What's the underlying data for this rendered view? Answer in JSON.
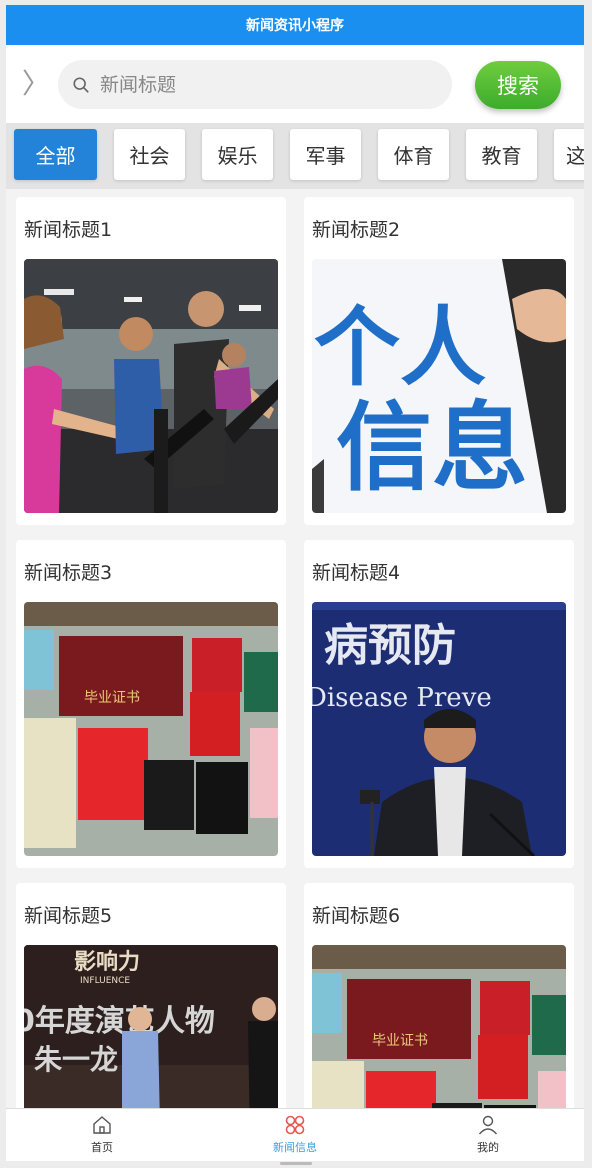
{
  "app": {
    "title": "新闻资讯小程序"
  },
  "search": {
    "placeholder": "新闻标题",
    "button_label": "搜索"
  },
  "tabs": [
    {
      "label": "全部",
      "active": true
    },
    {
      "label": "社会",
      "active": false
    },
    {
      "label": "娱乐",
      "active": false
    },
    {
      "label": "军事",
      "active": false
    },
    {
      "label": "体育",
      "active": false
    },
    {
      "label": "教育",
      "active": false
    },
    {
      "label": "这",
      "active": false
    }
  ],
  "news": [
    {
      "title": "新闻标题1",
      "image": "gym-photo"
    },
    {
      "title": "新闻标题2",
      "image": "personal-info-photo",
      "image_text": [
        "个人",
        "信息"
      ]
    },
    {
      "title": "新闻标题3",
      "image": "certificates-photo",
      "image_text": [
        "毕业证书"
      ]
    },
    {
      "title": "新闻标题4",
      "image": "press-conference-photo",
      "image_text": [
        "病预防",
        "Disease Preve"
      ]
    },
    {
      "title": "新闻标题5",
      "image": "stage-event-photo",
      "image_text": [
        "影响力",
        "INFLUENCE",
        "0年度演艺人物",
        "朱一龙"
      ]
    },
    {
      "title": "新闻标题6",
      "image": "certificates-photo",
      "image_text": [
        "毕业证书"
      ]
    }
  ],
  "bottom_nav": [
    {
      "label": "首页",
      "icon": "home-icon",
      "active": false
    },
    {
      "label": "新闻信息",
      "icon": "news-icon",
      "active": true
    },
    {
      "label": "我的",
      "icon": "user-icon",
      "active": false
    }
  ],
  "colors": {
    "header": "#1b8ff0",
    "active_tab": "#2383d8",
    "search_button": "#4cb833",
    "nav_active": "#3aa0d8"
  }
}
